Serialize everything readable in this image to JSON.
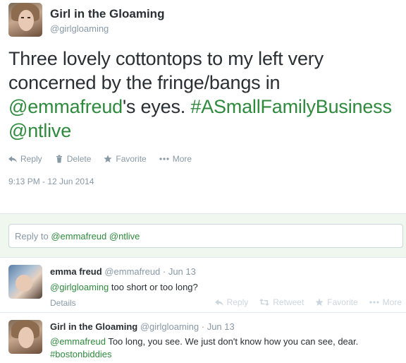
{
  "main_tweet": {
    "fullname": "Girl in the Gloaming",
    "handle": "@girlgloaming",
    "text_part1": "Three lovely cottontops to my left very concerned by the fringe/bangs in ",
    "mention": "@emmafreud",
    "text_part2": "'s eyes. ",
    "hashtag": "#ASmallFamilyBusiness",
    "space": " ",
    "mention2": "@ntlive",
    "actions": {
      "reply": "Reply",
      "delete": "Delete",
      "favorite": "Favorite",
      "more": "More"
    },
    "timestamp": "9:13 PM - 12 Jun 2014"
  },
  "reply_box": {
    "prefix": "Reply to ",
    "mentions": "@emmafreud @ntlive"
  },
  "replies": [
    {
      "fullname": "emma freud",
      "meta": "@emmafreud · Jun 13",
      "mention": "@girlgloaming",
      "text": " too short or too long?",
      "details": "Details",
      "actions": {
        "reply": "Reply",
        "retweet": "Retweet",
        "favorite": "Favorite",
        "more": "More"
      }
    },
    {
      "fullname": "Girl in the Gloaming",
      "meta": "@girlgloaming · Jun 13",
      "mention": "@emmafreud",
      "text": " Too long, you see. We just don't know how you can see, dear.",
      "hashtag": "#bostonbiddies"
    }
  ],
  "colors": {
    "link_green": "#2f8a3e",
    "muted": "#8899a6",
    "reply_bg": "#f0f7ee"
  }
}
